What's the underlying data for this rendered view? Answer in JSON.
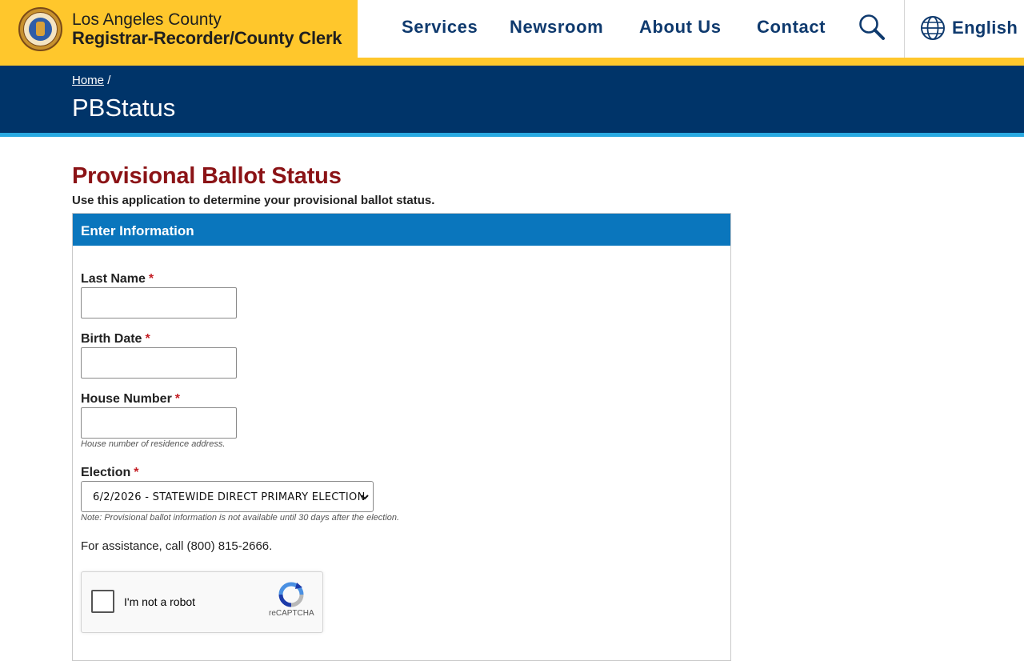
{
  "header": {
    "org_line1": "Los Angeles County",
    "org_line2": "Registrar-Recorder/County Clerk",
    "nav": [
      "Services",
      "Newsroom",
      "About Us",
      "Contact"
    ],
    "search_icon": "search-icon",
    "language": "English",
    "language_icon": "globe-icon"
  },
  "banner": {
    "breadcrumb_home": "Home",
    "breadcrumb_sep": "/",
    "title": "PBStatus"
  },
  "main": {
    "title": "Provisional Ballot Status",
    "intro": "Use this application to determine your provisional ballot status.",
    "panel_title": "Enter Information",
    "required_marker": "*",
    "fields": {
      "last_name": {
        "label": "Last Name",
        "value": ""
      },
      "birth_date": {
        "label": "Birth Date",
        "value": ""
      },
      "house_number": {
        "label": "House Number",
        "value": "",
        "hint": "House number of residence address."
      },
      "election": {
        "label": "Election",
        "selected": "6/2/2026 - STATEWIDE DIRECT PRIMARY ELECTION",
        "note": "Note: Provisional ballot information is not available until 30 days after the election."
      }
    },
    "assistance": "For assistance, call (800) 815-2666.",
    "captcha": {
      "label": "I'm not a robot",
      "brand": "reCAPTCHA"
    }
  },
  "colors": {
    "brand_gold": "#ffc72c",
    "nav_blue": "#0f3a6e",
    "banner_navy": "#003469",
    "accent_cyan": "#29a9e1",
    "title_red": "#8b1316",
    "panel_blue": "#0a76bd",
    "required_red": "#c41e24"
  }
}
